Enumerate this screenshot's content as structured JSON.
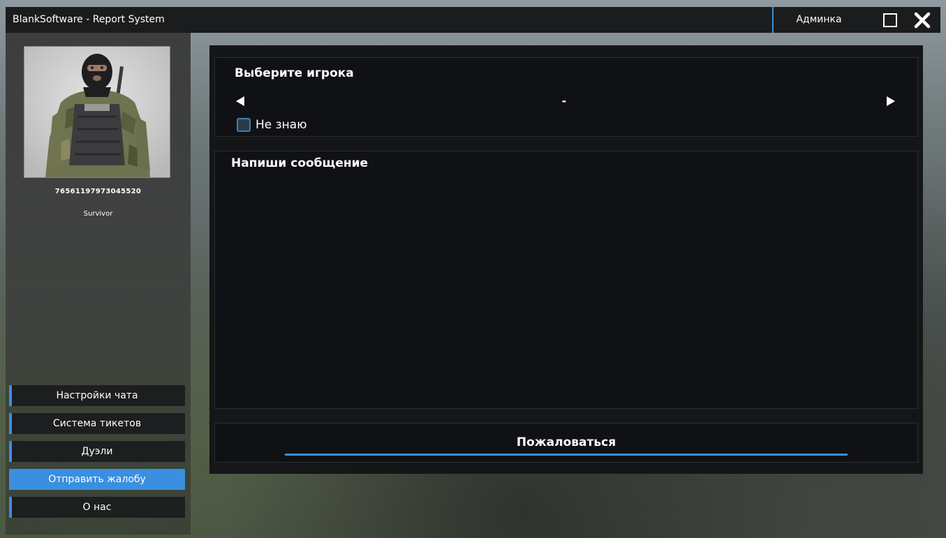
{
  "window": {
    "title": "BlankSoftware - Report System",
    "admin_label": "Админка",
    "maximize_icon": "maximize-icon",
    "close_icon": "close-icon"
  },
  "profile": {
    "avatar": "player-character-avatar",
    "steam_id": "76561197973045520",
    "name": "Survivor"
  },
  "sidebar": {
    "items": [
      {
        "label": "Настройки чата",
        "active": false
      },
      {
        "label": "Система тикетов",
        "active": false
      },
      {
        "label": "Дуэли",
        "active": false
      },
      {
        "label": "Отправить жалобу",
        "active": true
      },
      {
        "label": "О нас",
        "active": false
      }
    ]
  },
  "report": {
    "player_section_title": "Выберите игрока",
    "selected_player": "-",
    "prev_icon": "arrow-left-icon",
    "next_icon": "arrow-right-icon",
    "dont_know_label": "Не знаю",
    "dont_know_checked": false,
    "message_title": "Напиши сообщение",
    "message_value": "",
    "submit_label": "Пожаловаться"
  },
  "colors": {
    "accent": "#3a8fe0",
    "panel": "#151618",
    "titlebar": "#1b1c1e"
  }
}
